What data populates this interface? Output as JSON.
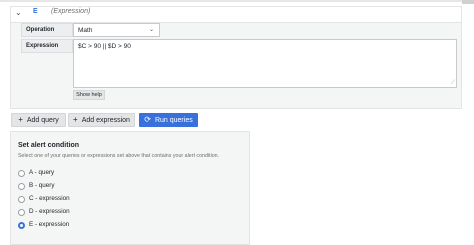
{
  "query": {
    "name": "E",
    "type_label": "(Expression)",
    "operation_label": "Operation",
    "operation_value": "Math",
    "expression_label": "Expression",
    "expression_value": "$C > 90 || $D > 90",
    "show_help_label": "Show help"
  },
  "toolbar": {
    "add_query_label": "Add query",
    "add_expression_label": "Add expression",
    "run_queries_label": "Run queries"
  },
  "alert_condition": {
    "title": "Set alert condition",
    "description": "Select one of your queries or expressions set above that contains your alert condition.",
    "options": [
      {
        "label": "A - query",
        "checked": false
      },
      {
        "label": "B - query",
        "checked": false
      },
      {
        "label": "C - expression",
        "checked": false
      },
      {
        "label": "D - expression",
        "checked": false
      },
      {
        "label": "E - expression",
        "checked": true
      }
    ]
  },
  "colors": {
    "accent": "#3871dc",
    "panel_bg": "#f4f5f5"
  }
}
